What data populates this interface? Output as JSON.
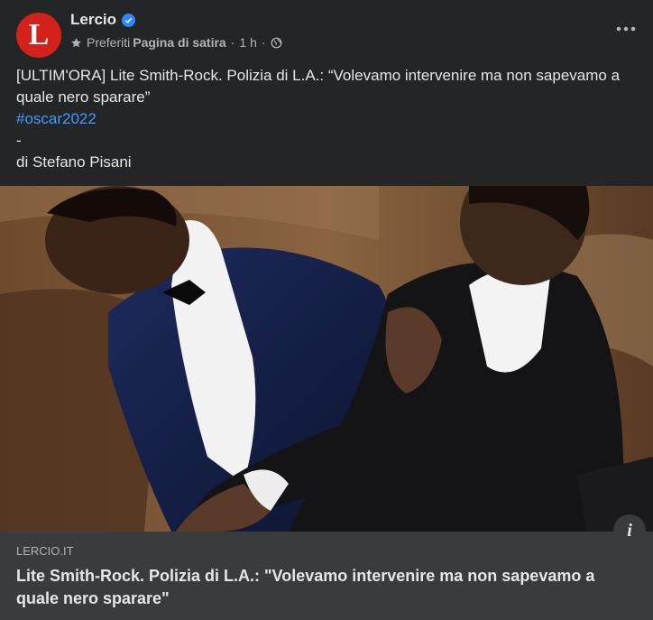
{
  "header": {
    "page_name": "Lercio",
    "avatar_letter": "L",
    "preferiti": "Preferiti",
    "page_type": "Pagina di satira",
    "separator": "·",
    "time": "1 h",
    "icons": [
      "verified-badge-icon",
      "star-icon",
      "globe-icon",
      "more-options-icon"
    ]
  },
  "post": {
    "line1": "[ULTIM'ORA] Lite Smith-Rock. Polizia di L.A.: “Volevamo intervenire ma non sapevamo a quale nero sparare”",
    "hashtag": "#oscar2022",
    "dash": "-",
    "byline": "di Stefano Pisani"
  },
  "link_preview": {
    "domain": "LERCIO.IT",
    "title": "Lite Smith-Rock. Polizia di L.A.: \"Volevamo intervenire ma non sapevamo a quale nero sparare\"",
    "info_icon": "i"
  },
  "colors": {
    "background": "#242526",
    "link_box": "#3a3b3c",
    "hashtag": "#4599ff",
    "avatar": "#d3211c",
    "verified": "#2d88ff"
  }
}
